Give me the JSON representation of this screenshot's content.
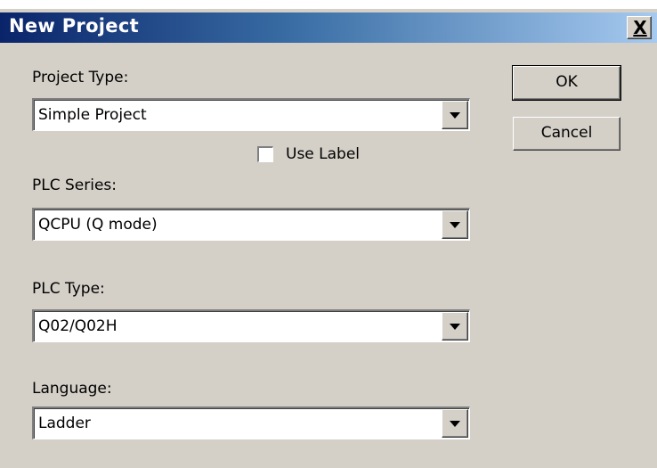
{
  "dialog": {
    "title": "New Project",
    "close_label": "X",
    "project_type": {
      "label": "Project Type:",
      "value": "Simple Project"
    },
    "use_label": {
      "label": "Use Label",
      "checked": false
    },
    "plc_series": {
      "label": "PLC Series:",
      "value": "QCPU (Q mode)"
    },
    "plc_type": {
      "label": "PLC Type:",
      "value": "Q02/Q02H"
    },
    "language": {
      "label": "Language:",
      "value": "Ladder"
    },
    "buttons": {
      "ok": "OK",
      "cancel": "Cancel"
    }
  },
  "colors": {
    "dialog_bg": "#d4d0c8",
    "titlebar_start": "#0a246a",
    "titlebar_end": "#a6caf0"
  }
}
